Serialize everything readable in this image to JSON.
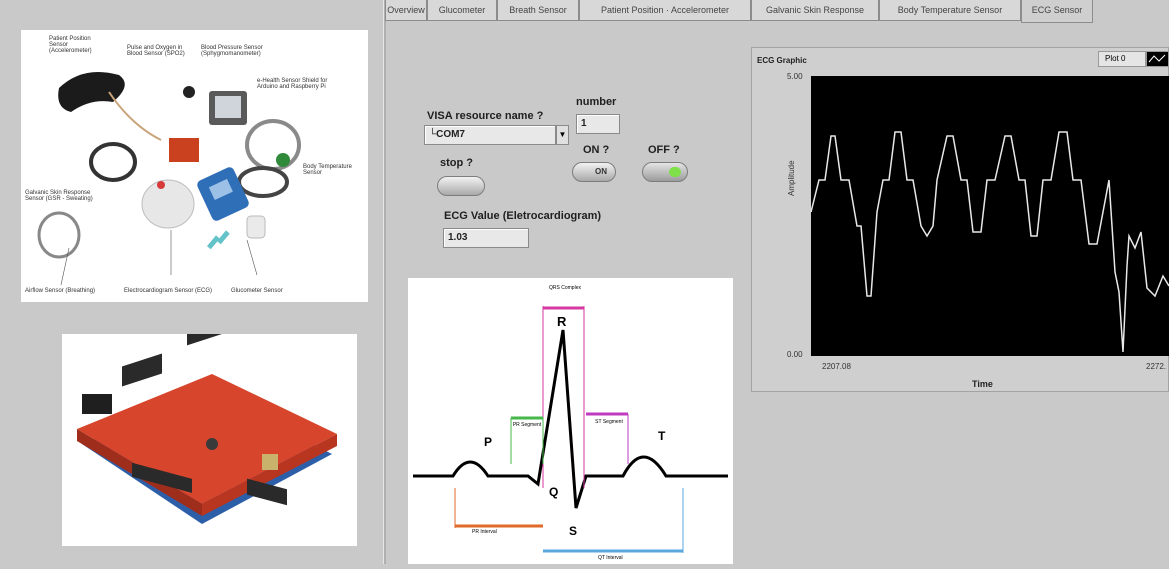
{
  "tabs": [
    "Overview",
    "Glucometer",
    "Breath Sensor",
    "Patient Position · Accelerometer",
    "Galvanic Skin Response",
    "Body Temperature Sensor",
    "ECG Sensor"
  ],
  "controls": {
    "visa_label": "VISA resource name ?",
    "visa_value": "COM7",
    "number_label": "number",
    "number_value": "1",
    "stop_label": "stop ?",
    "on_label": "ON ?",
    "on_switch_text": "ON",
    "off_label": "OFF ?",
    "ecg_value_label": "ECG Value (Eletrocardiogram)",
    "ecg_value": "1.03"
  },
  "ecg_graph": {
    "title": "ECG Graphic",
    "plot_legend": "Plot 0",
    "y_max_label": "5.00",
    "y_min_label": "0.00",
    "x_start_label": "2207.08",
    "x_end_label": "2272.",
    "ylabel": "Amplitude",
    "xlabel": "Time"
  },
  "sensor_photo": {
    "labels": [
      "Pulse and Oxygen in Blood Sensor (SPO2)",
      "Blood Pressure Sensor (Sphygmomanometer)",
      "e-Health Sensor Shield for Arduino and Raspberry Pi",
      "Body Temperature Sensor",
      "Airflow Sensor (Breathing)",
      "Electrocardiogram Sensor (ECG)",
      "Glucometer Sensor",
      "Galvanic Skin Response Sensor (GSR - Sweating)",
      "Patient Position Sensor (Accelerometer)"
    ]
  },
  "ecg_diagram": {
    "labels": {
      "qrs": "QRS Complex",
      "r": "R",
      "p": "P",
      "t": "T",
      "q": "Q",
      "s": "S",
      "pr_segment": "PR Segment",
      "st_segment": "ST Segment",
      "pr_interval": "PR Interval",
      "qt_interval": "QT Interval"
    }
  },
  "colors": {
    "plot_bg": "#000000",
    "trace": "#ffffff",
    "led_on": "#7fe04a"
  }
}
